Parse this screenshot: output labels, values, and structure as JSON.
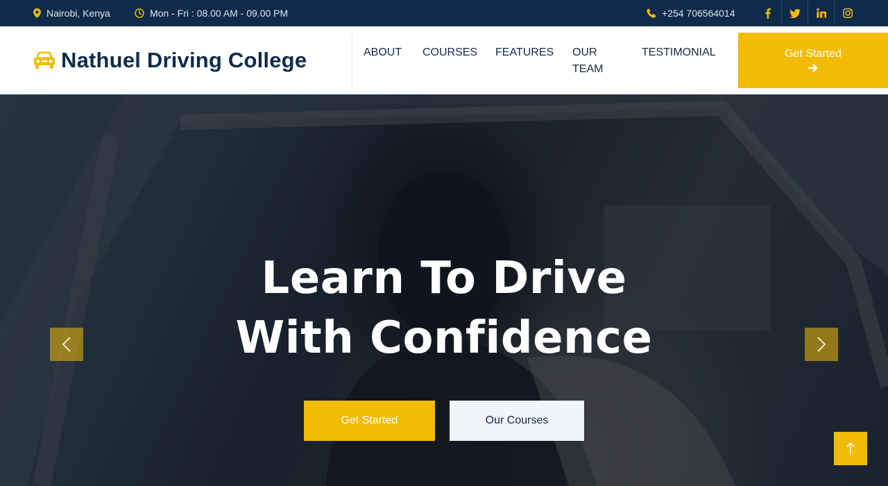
{
  "topbar": {
    "location": "Nairobi, Kenya",
    "hours": "Mon - Fri : 08.00 AM - 09.00 PM",
    "phone": "+254 706564014",
    "social_icons": [
      "facebook-icon",
      "twitter-icon",
      "linkedin-icon",
      "instagram-icon"
    ]
  },
  "brand": {
    "name": "Nathuel Driving College",
    "icon": "car-icon"
  },
  "nav": {
    "items": [
      {
        "label": "ABOUT"
      },
      {
        "label": "COURSES"
      },
      {
        "label": "FEATURES"
      },
      {
        "label": "OUR TEAM"
      },
      {
        "label": "TESTIMONIAL"
      }
    ],
    "cta_label": "Get Started"
  },
  "hero": {
    "line1": "Learn To Drive",
    "line2": "With Confidence",
    "primary_button": "Get Started",
    "secondary_button": "Our Courses"
  },
  "colors": {
    "navy": "#0f2b4a",
    "accent": "#f2bc05"
  }
}
